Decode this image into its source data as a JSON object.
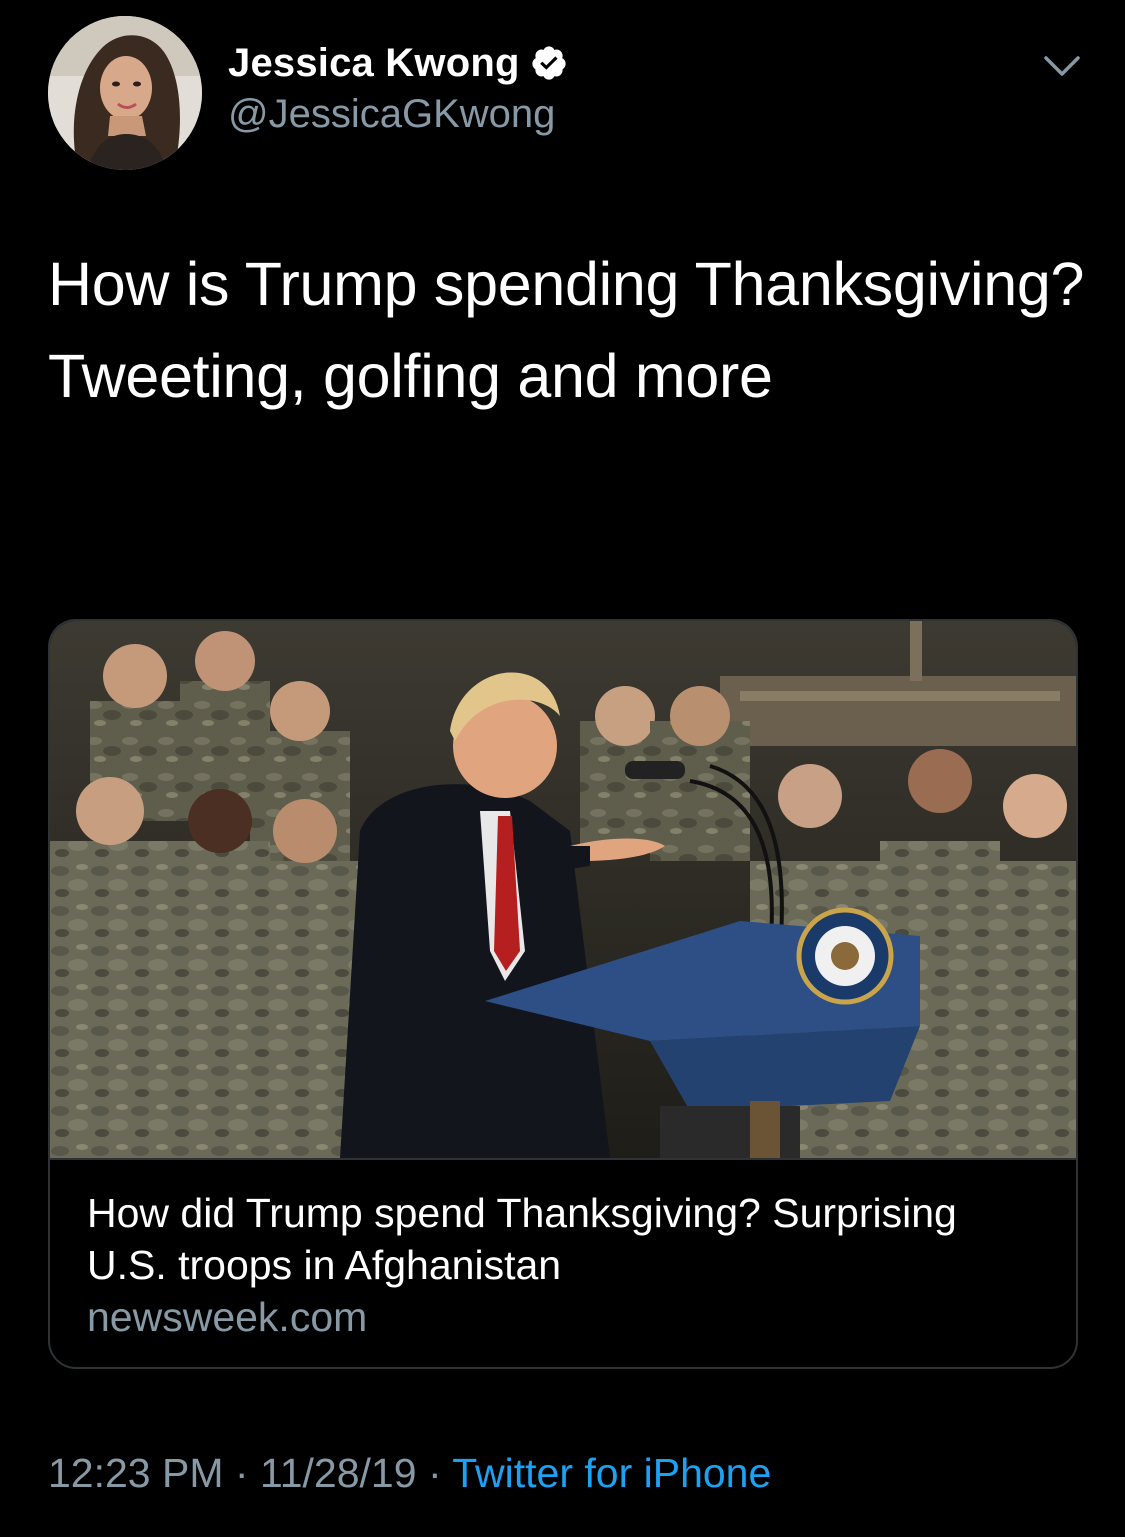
{
  "tweet": {
    "author": {
      "display_name": "Jessica Kwong",
      "handle": "@JessicaGKwong",
      "verified_icon": "verified-badge-icon",
      "avatar_icon": "profile-avatar"
    },
    "menu_icon": "chevron-down-icon",
    "text": "How is Trump spending Thanksgiving? Tweeting, golfing and more",
    "link_card": {
      "image_icon": "article-photo",
      "title": "How did Trump spend Thanksgiving? Surprising U.S. troops in Afghanistan",
      "domain": "newsweek.com"
    },
    "meta": {
      "time": "12:23 PM",
      "separator": "·",
      "date": "11/28/19",
      "source": "Twitter for iPhone"
    }
  },
  "colors": {
    "background": "#000000",
    "primary_text": "#ffffff",
    "secondary_text": "#8899a6",
    "link": "#1da1f2",
    "card_border": "#2f3336"
  }
}
